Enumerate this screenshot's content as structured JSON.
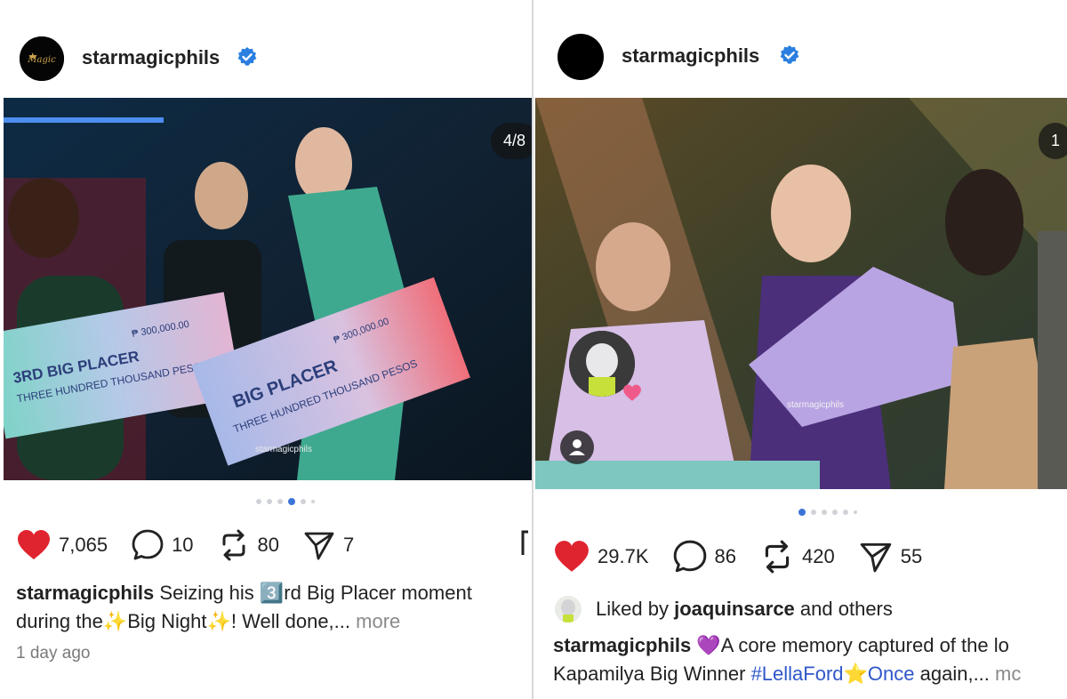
{
  "left_post": {
    "username": "starmagicphils",
    "counter": "4/8",
    "image_caption_watermark": "starmagicphils",
    "check1": {
      "placer": "3RD BIG PLACER",
      "amount_words": "THREE HUNDRED THOUSAND PESOS",
      "amount": "₱ 300,000.00"
    },
    "check2": {
      "placer": "BIG PLACER",
      "amount_words": "THREE HUNDRED THOUSAND PESOS",
      "amount": "₱ 300,000.00"
    },
    "likes": "7,065",
    "comments": "10",
    "reposts": "80",
    "shares": "7",
    "caption_line1": "Seizing his 3️⃣rd Big Placer moment",
    "caption_line2": "during the✨Big Night✨! Well done,...",
    "more": "more",
    "time": "1 day ago"
  },
  "right_post": {
    "username": "starmagicphils",
    "counter": "1",
    "image_caption_watermark": "starmagicphils",
    "likes": "29.7K",
    "comments": "86",
    "reposts": "420",
    "shares": "55",
    "liked_prefix": "Liked by",
    "liked_user": "joaquinsarce",
    "liked_suffix": "and others",
    "caption_line1": "💜A core memory captured of the lo",
    "caption_line2_a": "Kapamilya Big Winner",
    "hashtag": "#LellaFord",
    "caption_line2_b": "⭐Once",
    "caption_line2_c": "again,...",
    "more": "mc"
  },
  "colors": {
    "heart": "#e0242f",
    "verified": "#2b7fe0",
    "hashtag": "#2f57c9",
    "dot_active": "#3d74d8"
  },
  "icons": [
    "heart-icon",
    "comment-icon",
    "repost-icon",
    "share-icon",
    "verified-badge-icon",
    "user-icon"
  ]
}
